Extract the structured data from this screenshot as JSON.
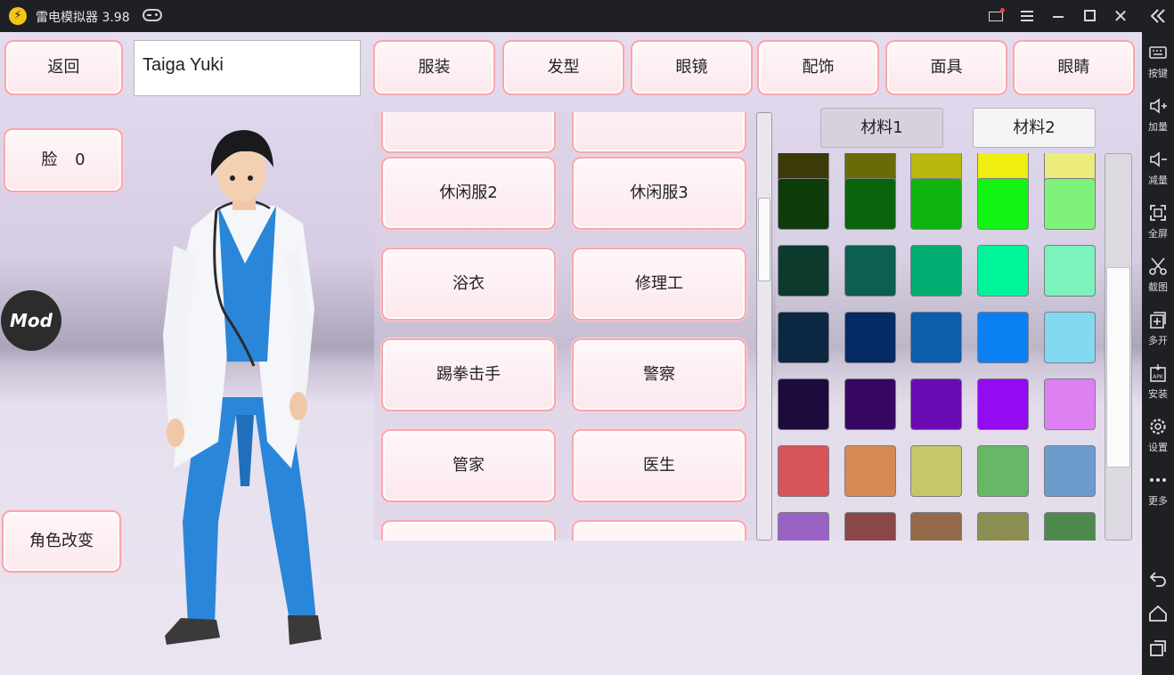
{
  "titlebar": {
    "app_name": "雷电模拟器 3.98"
  },
  "top_bar": {
    "back_label": "返回",
    "name_value": "Taiga Yuki",
    "tabs": [
      "服装",
      "发型",
      "眼镜",
      "配饰",
      "面具",
      "眼睛"
    ]
  },
  "left_panel": {
    "face_label": "脸",
    "face_value": "0",
    "mod_label": "Mod",
    "change_char_label": "角色改变"
  },
  "outfit_list": {
    "items": [
      "",
      "",
      "休闲服2",
      "休闲服3",
      "浴衣",
      "修理工",
      "踢拳击手",
      "警察",
      "管家",
      "医生",
      "",
      ""
    ]
  },
  "materials": {
    "tab1": "材料1",
    "tab2": "材料2",
    "selected": "材料2"
  },
  "colors": [
    [
      "#3c3a08",
      "#6a6a06",
      "#b8b80e",
      "#eeee10",
      "#ecec7c"
    ],
    [
      "#0d3b0a",
      "#0a640b",
      "#0fb40f",
      "#12f414",
      "#7ff27c"
    ],
    [
      "#0c3b2e",
      "#0b6050",
      "#00ac70",
      "#00f498",
      "#7cf2bd"
    ],
    [
      "#0c2742",
      "#062a63",
      "#0a5eab",
      "#0a80f2",
      "#83d8f2"
    ],
    [
      "#1d0b3d",
      "#380763",
      "#6a0bb4",
      "#940bf2",
      "#dd80f2"
    ],
    [
      "#d5555a",
      "#d58a52",
      "#c7c76a",
      "#68b766",
      "#6c9ccc"
    ],
    [
      "#9a62c2",
      "#8a4848",
      "#946a4a",
      "#8c8e54",
      "#4e8a4e"
    ]
  ],
  "sidebar": {
    "items": [
      {
        "label": "按键",
        "icon": "keyboard-icon"
      },
      {
        "label": "加量",
        "icon": "volume-up-icon"
      },
      {
        "label": "减量",
        "icon": "volume-down-icon"
      },
      {
        "label": "全屏",
        "icon": "fullscreen-icon"
      },
      {
        "label": "截图",
        "icon": "scissors-icon"
      },
      {
        "label": "多开",
        "icon": "multi-open-icon"
      },
      {
        "label": "安装",
        "icon": "apk-install-icon"
      },
      {
        "label": "设置",
        "icon": "gear-icon"
      },
      {
        "label": "更多",
        "icon": "more-icon"
      }
    ]
  }
}
